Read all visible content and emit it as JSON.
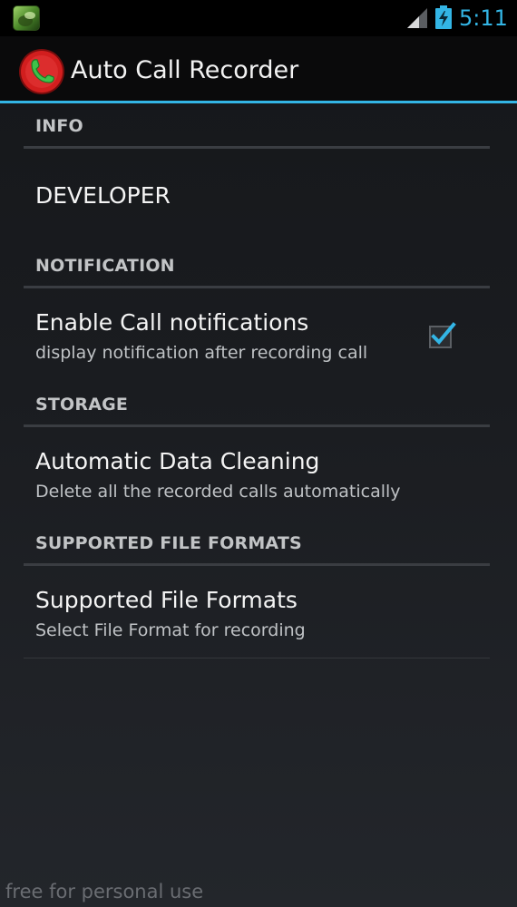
{
  "status_bar": {
    "time": "5:11",
    "icons": {
      "notification": "app-notification-icon",
      "signal": "signal-strength-icon",
      "battery": "battery-charging-icon"
    }
  },
  "action_bar": {
    "title": "Auto Call Recorder",
    "logo_icon": "phone-handset-icon",
    "accent_color": "#33b5e5"
  },
  "preferences": {
    "categories": [
      {
        "label": "INFO",
        "items": [
          {
            "title": "DEVELOPER"
          }
        ]
      },
      {
        "label": "NOTIFICATION",
        "items": [
          {
            "title": "Enable Call notifications",
            "summary": "display notification after recording call",
            "checked": true
          }
        ]
      },
      {
        "label": "STORAGE",
        "items": [
          {
            "title": "Automatic Data Cleaning",
            "summary": "Delete all the recorded calls automatically"
          }
        ]
      },
      {
        "label": "SUPPORTED FILE FORMATS",
        "items": [
          {
            "title": "Supported File Formats",
            "summary": "Select File Format for recording"
          }
        ]
      }
    ]
  },
  "watermark": "free for personal use"
}
